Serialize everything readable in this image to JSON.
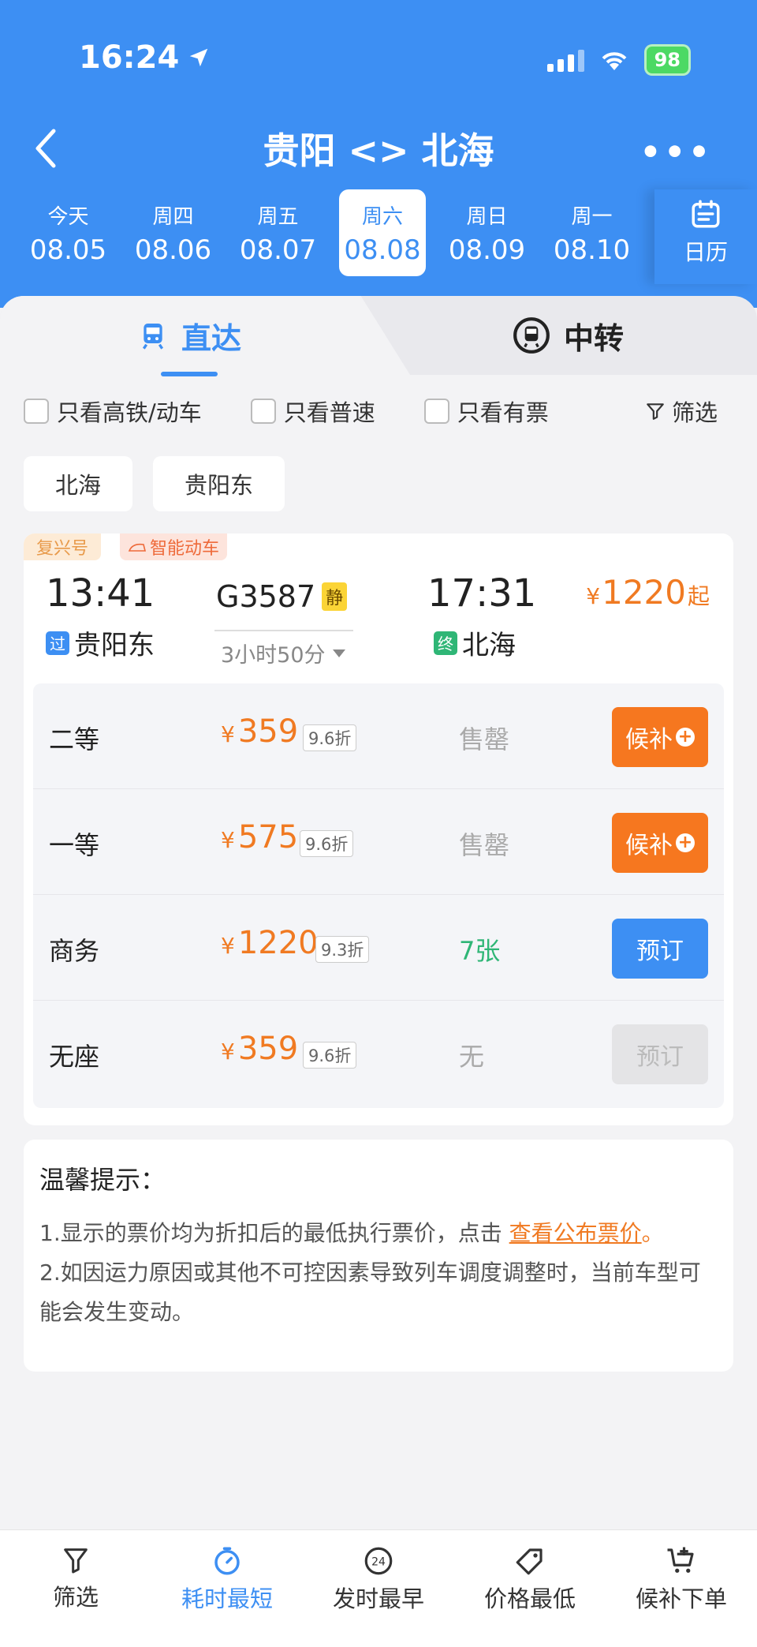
{
  "status": {
    "time": "16:24",
    "battery": "98"
  },
  "nav": {
    "title": "贵阳 <> 北海"
  },
  "dates": [
    {
      "week": "今天",
      "date": "08.05"
    },
    {
      "week": "周四",
      "date": "08.06"
    },
    {
      "week": "周五",
      "date": "08.07"
    },
    {
      "week": "周六",
      "date": "08.08"
    },
    {
      "week": "周日",
      "date": "08.09"
    },
    {
      "week": "周一",
      "date": "08.10"
    }
  ],
  "calendar_label": "日历",
  "tabs": {
    "direct": "直达",
    "transfer": "中转"
  },
  "filters": {
    "high_speed": "只看高铁/动车",
    "normal": "只看普速",
    "available": "只看有票",
    "filter": "筛选"
  },
  "stations": [
    "北海",
    "贵阳东"
  ],
  "train": {
    "tag1": "复兴号",
    "tag2": "智能动车",
    "dep_time": "13:41",
    "arr_time": "17:31",
    "dep_badge": "过",
    "dep_station": "贵阳东",
    "arr_badge": "终",
    "arr_station": "北海",
    "number": "G3587",
    "quiet": "静",
    "duration": "3小时50分",
    "price_yen": "¥",
    "price_from": "1220",
    "price_suffix": "起",
    "seats": [
      {
        "name": "二等",
        "yen": "¥",
        "price": "359",
        "discount": "9.6折",
        "avail": "售罄",
        "action": "候补"
      },
      {
        "name": "一等",
        "yen": "¥",
        "price": "575",
        "discount": "9.6折",
        "avail": "售罄",
        "action": "候补"
      },
      {
        "name": "商务",
        "yen": "¥",
        "price": "1220",
        "discount": "9.3折",
        "avail": "7张",
        "action": "预订"
      },
      {
        "name": "无座",
        "yen": "¥",
        "price": "359",
        "discount": "9.6折",
        "avail": "无",
        "action": "预订"
      }
    ]
  },
  "tips": {
    "title": "温馨提示：",
    "line1_prefix": "1.显示的票价均为折扣后的最低执行票价，点击 ",
    "line1_link": "查看公布票价",
    "line1_suffix": "。",
    "line2": "2.如因运力原因或其他不可控因素导致列车调度调整时，当前车型可能会发生变动。"
  },
  "bottom": {
    "filter": "筛选",
    "shortest": "耗时最短",
    "earliest": "发时最早",
    "cheapest": "价格最低",
    "waitlist": "候补下单"
  },
  "colors": {
    "primary": "#3d8ff3",
    "orange": "#f6771f",
    "green": "#2fb676"
  }
}
